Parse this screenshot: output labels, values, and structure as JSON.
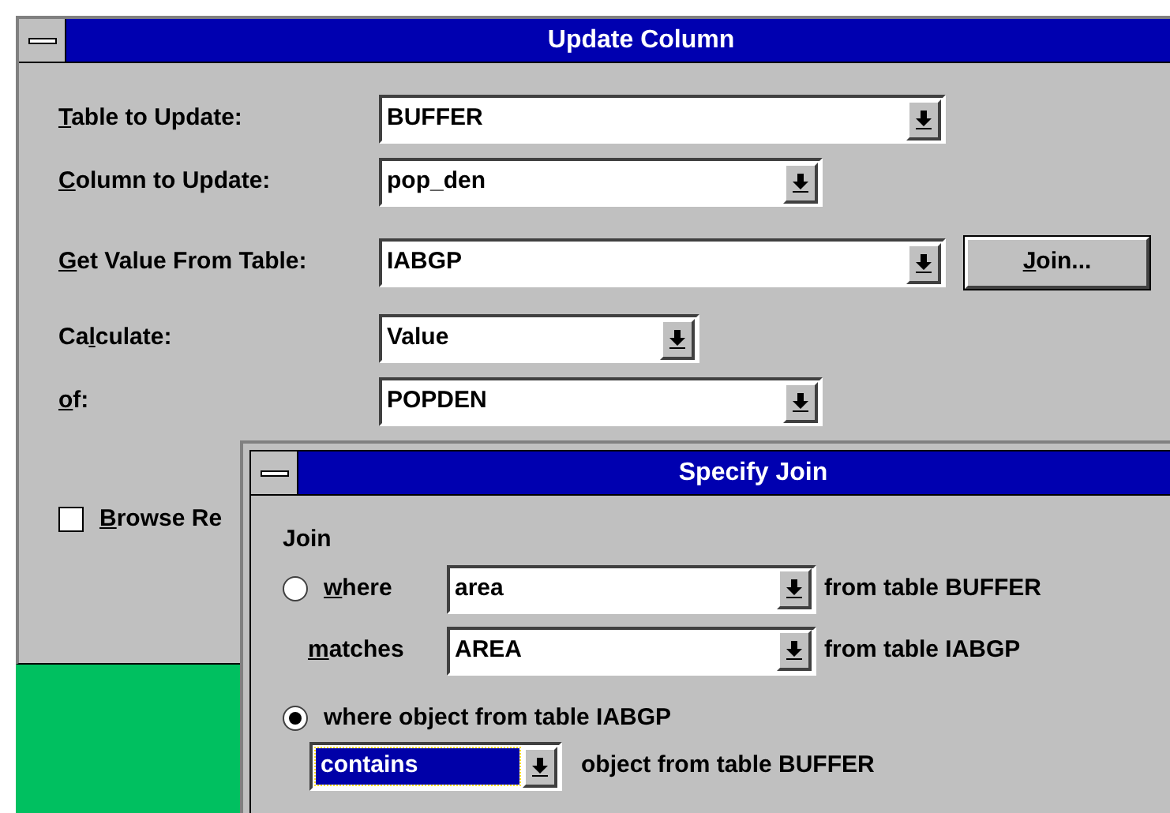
{
  "main_window": {
    "title": "Update Column",
    "fields": [
      {
        "label": {
          "key": "T",
          "post": "able to Update:"
        },
        "value": "BUFFER"
      },
      {
        "label": {
          "key": "C",
          "post": "olumn to Update:"
        },
        "value": "pop_den"
      },
      {
        "label": {
          "key": "G",
          "post": "et Value From Table:"
        },
        "value": "IABGP"
      },
      {
        "label": {
          "pre": "Ca",
          "key": "l",
          "post": "culate:"
        },
        "value": "Value"
      },
      {
        "label": {
          "key": "o",
          "post": "f:"
        },
        "value": "POPDEN"
      }
    ],
    "join_button": {
      "key": "J",
      "post": "oin..."
    },
    "browse_checkbox": {
      "label": {
        "key": "B",
        "post": "rowse Re"
      },
      "checked": false
    }
  },
  "join_dialog": {
    "title": "Specify Join",
    "group_label": "Join",
    "options": [
      {
        "selected": false,
        "label": {
          "key": "w",
          "post": "here"
        },
        "value": "area",
        "suffix": "from table BUFFER",
        "match_label": {
          "key": "m",
          "post": "atches"
        },
        "match_value": "AREA",
        "match_suffix": "from table IABGP"
      },
      {
        "selected": true,
        "label": {
          "pre": "where object from table IABGP"
        },
        "value": "contains",
        "suffix": "object from table BUFFER"
      }
    ]
  }
}
